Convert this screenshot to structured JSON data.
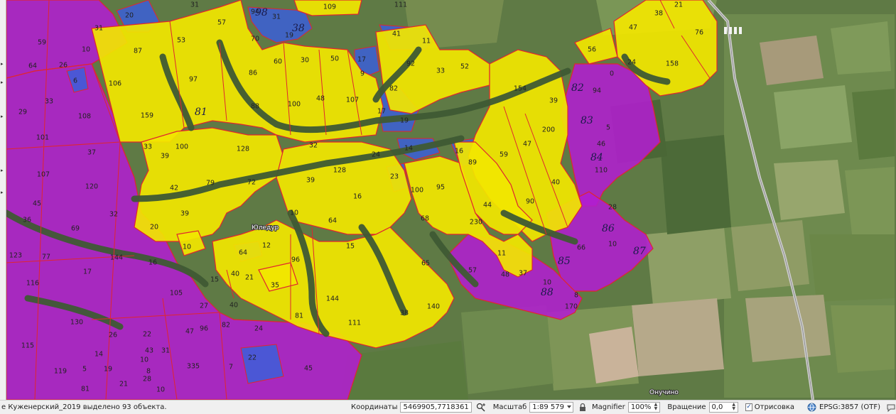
{
  "map": {
    "place_labels": [
      "Юледур",
      "Онучино"
    ],
    "colors": {
      "field_yellow": "#f2e600",
      "field_magenta": "#b21ed0",
      "field_blue": "#3b5fd8",
      "boundary_red": "#e0262f",
      "imagery_green": "#5f7a45"
    },
    "field_labels": [
      "109",
      "111",
      "20",
      "31",
      "94",
      "31",
      "57",
      "70",
      "19",
      "41",
      "11",
      "31",
      "59",
      "10",
      "64",
      "26",
      "6",
      "87",
      "53",
      "97",
      "60",
      "30",
      "50",
      "17",
      "9",
      "92",
      "33",
      "52",
      "56",
      "47",
      "38",
      "21",
      "76",
      "24",
      "158",
      "0",
      "94",
      "106",
      "159",
      "86",
      "88",
      "100",
      "48",
      "107",
      "82",
      "17",
      "19",
      "154",
      "39",
      "29",
      "33",
      "108",
      "101",
      "37",
      "107",
      "120",
      "45",
      "36",
      "32",
      "69",
      "123",
      "77",
      "17",
      "116",
      "144",
      "16",
      "105",
      "27",
      "130",
      "115",
      "119",
      "81",
      "5",
      "26",
      "14",
      "19",
      "21",
      "22",
      "10",
      "43",
      "31",
      "47",
      "96",
      "82",
      "24",
      "335",
      "7",
      "22",
      "45",
      "8",
      "28",
      "10",
      "33",
      "39",
      "100",
      "128",
      "32",
      "24",
      "14",
      "16",
      "89",
      "59",
      "47",
      "200",
      "5",
      "46",
      "110",
      "40",
      "90",
      "42",
      "79",
      "72",
      "39",
      "20",
      "10",
      "39",
      "128",
      "16",
      "23",
      "100",
      "95",
      "44",
      "10",
      "64",
      "68",
      "230",
      "15",
      "12",
      "64",
      "96",
      "35",
      "40",
      "21",
      "15",
      "40",
      "81",
      "144",
      "111",
      "38",
      "140",
      "65",
      "57",
      "11",
      "48",
      "37",
      "10",
      "8",
      "170",
      "66",
      "10",
      "28"
    ],
    "handwritten_labels": [
      "98",
      "38",
      "81",
      "82",
      "83",
      "84",
      "85",
      "86",
      "87",
      "88"
    ]
  },
  "status": {
    "message": "е Куженерский_2019 выделено 93 объекта.",
    "coord_label": "Координаты",
    "coord_value": "5469905,7718361",
    "scale_label": "Масштаб",
    "scale_value": "1:89 579",
    "magnifier_label": "Magnifier",
    "magnifier_value": "100%",
    "rotation_label": "Вращение",
    "rotation_value": "0,0",
    "render_label": "Отрисовка",
    "render_checked": true,
    "crs_label": "EPSG:3857 (OTF)"
  }
}
